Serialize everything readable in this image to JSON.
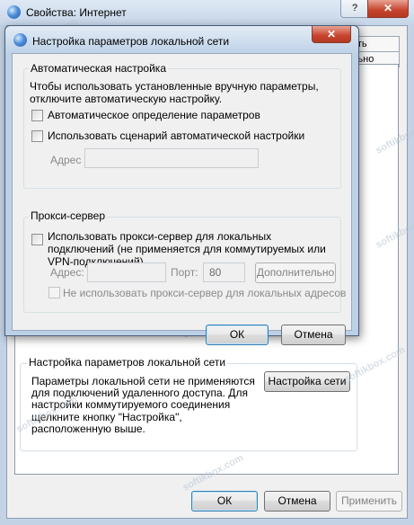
{
  "bg_window": {
    "title": "Свойства: Интернет",
    "help_label": "?",
    "close_label": "✕",
    "tab_partial_1": "ать",
    "tab_partial_2": "льно",
    "lan_group_title": "Настройка параметров локальной сети",
    "lan_description": "Параметры локальной сети не применяются для подключений удаленного доступа. Для настройки коммутируемого соединения щелкните кнопку \"Настройка\", расположенную выше.",
    "lan_settings_button": "Настройка сети",
    "ok_button": "ОК",
    "cancel_button": "Отмена",
    "apply_button": "Применить"
  },
  "dialog": {
    "title": "Настройка параметров локальной сети",
    "close_label": "✕",
    "auto_group": {
      "title": "Автоматическая настройка",
      "description": "Чтобы использовать установленные вручную параметры, отключите автоматическую настройку.",
      "auto_detect_label": "Автоматическое определение параметров",
      "auto_detect_checked": false,
      "use_script_label": "Использовать сценарий автоматической настройки",
      "use_script_checked": false,
      "address_label": "Адрес",
      "address_value": ""
    },
    "proxy_group": {
      "title": "Прокси-сервер",
      "use_proxy_label": "Использовать прокси-сервер для локальных подключений (не применяется для коммутируемых или VPN-подключений).",
      "use_proxy_checked": false,
      "address_label": "Адрес:",
      "address_value": "",
      "port_label": "Порт:",
      "port_value": "80",
      "advanced_button": "Дополнительно",
      "bypass_label": "Не использовать прокси-сервер для локальных адресов",
      "bypass_checked": false
    },
    "ok_button": "ОК",
    "cancel_button": "Отмена"
  },
  "watermark": "softikbox.com"
}
